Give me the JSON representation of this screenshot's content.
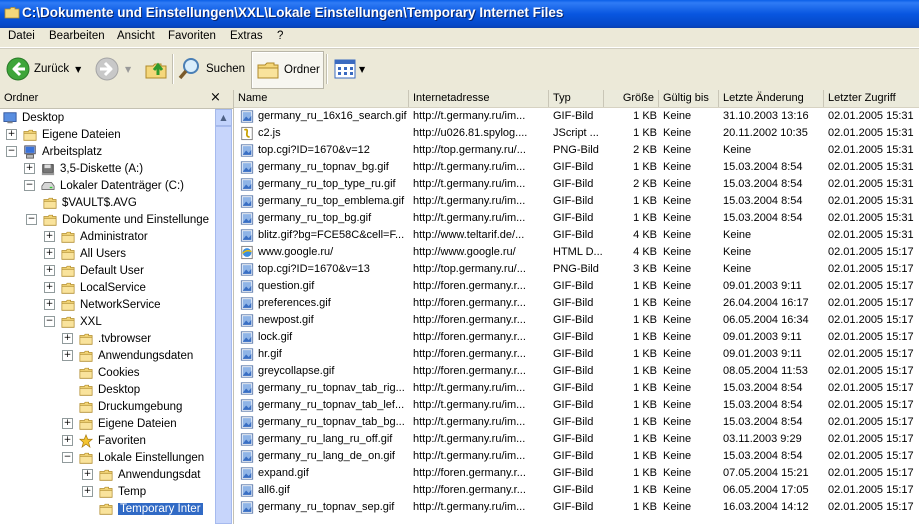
{
  "window": {
    "title": "C:\\Dokumente und Einstellungen\\XXL\\Lokale Einstellungen\\Temporary Internet Files"
  },
  "menu": [
    "Datei",
    "Bearbeiten",
    "Ansicht",
    "Favoriten",
    "Extras",
    "?"
  ],
  "toolbar": {
    "back_label": "Zurück",
    "search_label": "Suchen",
    "folders_label": "Ordner"
  },
  "left_pane": {
    "title": "Ordner",
    "close": "×"
  },
  "tree": [
    {
      "label": "Desktop",
      "level": 0,
      "expander": "",
      "icon": "desktop"
    },
    {
      "label": "Eigene Dateien",
      "level": 1,
      "expander": "+",
      "icon": "folder"
    },
    {
      "label": "Arbeitsplatz",
      "level": 1,
      "expander": "−",
      "icon": "computer"
    },
    {
      "label": "3,5-Diskette (A:)",
      "level": 2,
      "expander": "+",
      "icon": "floppy"
    },
    {
      "label": "Lokaler Datenträger (C:)",
      "level": 2,
      "expander": "−",
      "icon": "drive"
    },
    {
      "label": "$VAULT$.AVG",
      "level": 3,
      "expander": "",
      "icon": "folder"
    },
    {
      "label": "Dokumente und Einstellunge",
      "level": 3,
      "expander": "−",
      "icon": "folder"
    },
    {
      "label": "Administrator",
      "level": 4,
      "expander": "+",
      "icon": "folder"
    },
    {
      "label": "All Users",
      "level": 4,
      "expander": "+",
      "icon": "folder"
    },
    {
      "label": "Default User",
      "level": 4,
      "expander": "+",
      "icon": "folder"
    },
    {
      "label": "LocalService",
      "level": 4,
      "expander": "+",
      "icon": "folder"
    },
    {
      "label": "NetworkService",
      "level": 4,
      "expander": "+",
      "icon": "folder"
    },
    {
      "label": "XXL",
      "level": 4,
      "expander": "−",
      "icon": "folder"
    },
    {
      "label": ".tvbrowser",
      "level": 5,
      "expander": "+",
      "icon": "folder"
    },
    {
      "label": "Anwendungsdaten",
      "level": 5,
      "expander": "+",
      "icon": "folder"
    },
    {
      "label": "Cookies",
      "level": 5,
      "expander": "",
      "icon": "folder"
    },
    {
      "label": "Desktop",
      "level": 5,
      "expander": "",
      "icon": "folder"
    },
    {
      "label": "Druckumgebung",
      "level": 5,
      "expander": "",
      "icon": "folder"
    },
    {
      "label": "Eigene Dateien",
      "level": 5,
      "expander": "+",
      "icon": "folder"
    },
    {
      "label": "Favoriten",
      "level": 5,
      "expander": "+",
      "icon": "star"
    },
    {
      "label": "Lokale Einstellungen",
      "level": 5,
      "expander": "−",
      "icon": "folder"
    },
    {
      "label": "Anwendungsdat",
      "level": 6,
      "expander": "+",
      "icon": "folder"
    },
    {
      "label": "Temp",
      "level": 6,
      "expander": "+",
      "icon": "folder"
    },
    {
      "label": "Temporary Inter",
      "level": 6,
      "expander": "",
      "icon": "folder",
      "selected": true
    }
  ],
  "columns": [
    "Name",
    "Internetadresse",
    "Typ",
    "Größe",
    "Gültig bis",
    "Letzte Änderung",
    "Letzter Zugriff"
  ],
  "files": [
    {
      "name": "germany_ru_16x16_search.gif",
      "url": "http://t.germany.ru/im...",
      "type": "GIF-Bild",
      "size": "1 KB",
      "expires": "Keine",
      "modified": "31.10.2003 13:16",
      "accessed": "02.01.2005 15:31",
      "icon": "img"
    },
    {
      "name": "c2.js",
      "url": "http://u026.81.spylog....",
      "type": "JScript ...",
      "size": "1 KB",
      "expires": "Keine",
      "modified": "20.11.2002 10:35",
      "accessed": "02.01.2005 15:31",
      "icon": "js"
    },
    {
      "name": "top.cgi?ID=1670&v=12",
      "url": "http://top.germany.ru/...",
      "type": "PNG-Bild",
      "size": "2 KB",
      "expires": "Keine",
      "modified": "Keine",
      "accessed": "02.01.2005 15:31",
      "icon": "img"
    },
    {
      "name": "germany_ru_topnav_bg.gif",
      "url": "http://t.germany.ru/im...",
      "type": "GIF-Bild",
      "size": "1 KB",
      "expires": "Keine",
      "modified": "15.03.2004 8:54",
      "accessed": "02.01.2005 15:31",
      "icon": "img"
    },
    {
      "name": "germany_ru_top_type_ru.gif",
      "url": "http://t.germany.ru/im...",
      "type": "GIF-Bild",
      "size": "2 KB",
      "expires": "Keine",
      "modified": "15.03.2004 8:54",
      "accessed": "02.01.2005 15:31",
      "icon": "img"
    },
    {
      "name": "germany_ru_top_emblema.gif",
      "url": "http://t.germany.ru/im...",
      "type": "GIF-Bild",
      "size": "1 KB",
      "expires": "Keine",
      "modified": "15.03.2004 8:54",
      "accessed": "02.01.2005 15:31",
      "icon": "img"
    },
    {
      "name": "germany_ru_top_bg.gif",
      "url": "http://t.germany.ru/im...",
      "type": "GIF-Bild",
      "size": "1 KB",
      "expires": "Keine",
      "modified": "15.03.2004 8:54",
      "accessed": "02.01.2005 15:31",
      "icon": "img"
    },
    {
      "name": "blitz.gif?bg=FCE58C&cell=F...",
      "url": "http://www.teltarif.de/...",
      "type": "GIF-Bild",
      "size": "4 KB",
      "expires": "Keine",
      "modified": "Keine",
      "accessed": "02.01.2005 15:31",
      "icon": "img"
    },
    {
      "name": "www.google.ru/",
      "url": "http://www.google.ru/",
      "type": "HTML D...",
      "size": "4 KB",
      "expires": "Keine",
      "modified": "Keine",
      "accessed": "02.01.2005 15:17",
      "icon": "html"
    },
    {
      "name": "top.cgi?ID=1670&v=13",
      "url": "http://top.germany.ru/...",
      "type": "PNG-Bild",
      "size": "3 KB",
      "expires": "Keine",
      "modified": "Keine",
      "accessed": "02.01.2005 15:17",
      "icon": "img"
    },
    {
      "name": "question.gif",
      "url": "http://foren.germany.r...",
      "type": "GIF-Bild",
      "size": "1 KB",
      "expires": "Keine",
      "modified": "09.01.2003 9:11",
      "accessed": "02.01.2005 15:17",
      "icon": "img"
    },
    {
      "name": "preferences.gif",
      "url": "http://foren.germany.r...",
      "type": "GIF-Bild",
      "size": "1 KB",
      "expires": "Keine",
      "modified": "26.04.2004 16:17",
      "accessed": "02.01.2005 15:17",
      "icon": "img"
    },
    {
      "name": "newpost.gif",
      "url": "http://foren.germany.r...",
      "type": "GIF-Bild",
      "size": "1 KB",
      "expires": "Keine",
      "modified": "06.05.2004 16:34",
      "accessed": "02.01.2005 15:17",
      "icon": "img"
    },
    {
      "name": "lock.gif",
      "url": "http://foren.germany.r...",
      "type": "GIF-Bild",
      "size": "1 KB",
      "expires": "Keine",
      "modified": "09.01.2003 9:11",
      "accessed": "02.01.2005 15:17",
      "icon": "img"
    },
    {
      "name": "hr.gif",
      "url": "http://foren.germany.r...",
      "type": "GIF-Bild",
      "size": "1 KB",
      "expires": "Keine",
      "modified": "09.01.2003 9:11",
      "accessed": "02.01.2005 15:17",
      "icon": "img"
    },
    {
      "name": "greycollapse.gif",
      "url": "http://foren.germany.r...",
      "type": "GIF-Bild",
      "size": "1 KB",
      "expires": "Keine",
      "modified": "08.05.2004 11:53",
      "accessed": "02.01.2005 15:17",
      "icon": "img"
    },
    {
      "name": "germany_ru_topnav_tab_rig...",
      "url": "http://t.germany.ru/im...",
      "type": "GIF-Bild",
      "size": "1 KB",
      "expires": "Keine",
      "modified": "15.03.2004 8:54",
      "accessed": "02.01.2005 15:17",
      "icon": "img"
    },
    {
      "name": "germany_ru_topnav_tab_lef...",
      "url": "http://t.germany.ru/im...",
      "type": "GIF-Bild",
      "size": "1 KB",
      "expires": "Keine",
      "modified": "15.03.2004 8:54",
      "accessed": "02.01.2005 15:17",
      "icon": "img"
    },
    {
      "name": "germany_ru_topnav_tab_bg...",
      "url": "http://t.germany.ru/im...",
      "type": "GIF-Bild",
      "size": "1 KB",
      "expires": "Keine",
      "modified": "15.03.2004 8:54",
      "accessed": "02.01.2005 15:17",
      "icon": "img"
    },
    {
      "name": "germany_ru_lang_ru_off.gif",
      "url": "http://t.germany.ru/im...",
      "type": "GIF-Bild",
      "size": "1 KB",
      "expires": "Keine",
      "modified": "03.11.2003 9:29",
      "accessed": "02.01.2005 15:17",
      "icon": "img"
    },
    {
      "name": "germany_ru_lang_de_on.gif",
      "url": "http://t.germany.ru/im...",
      "type": "GIF-Bild",
      "size": "1 KB",
      "expires": "Keine",
      "modified": "15.03.2004 8:54",
      "accessed": "02.01.2005 15:17",
      "icon": "img"
    },
    {
      "name": "expand.gif",
      "url": "http://foren.germany.r...",
      "type": "GIF-Bild",
      "size": "1 KB",
      "expires": "Keine",
      "modified": "07.05.2004 15:21",
      "accessed": "02.01.2005 15:17",
      "icon": "img"
    },
    {
      "name": "all6.gif",
      "url": "http://foren.germany.r...",
      "type": "GIF-Bild",
      "size": "1 KB",
      "expires": "Keine",
      "modified": "06.05.2004 17:05",
      "accessed": "02.01.2005 15:17",
      "icon": "img"
    },
    {
      "name": "germany_ru_topnav_sep.gif",
      "url": "http://t.germany.ru/im...",
      "type": "GIF-Bild",
      "size": "1 KB",
      "expires": "Keine",
      "modified": "16.03.2004 14:12",
      "accessed": "02.01.2005 15:17",
      "icon": "img"
    }
  ],
  "colors": {
    "titlebar": "#0856e0",
    "selection": "#316ac5",
    "window_bg": "#ece9d8"
  }
}
